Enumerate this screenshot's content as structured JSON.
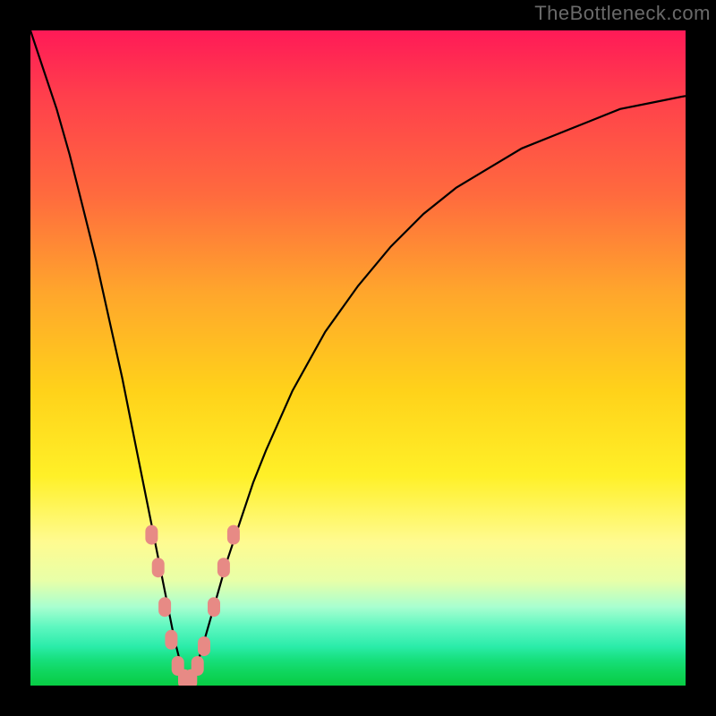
{
  "watermark": "TheBottleneck.com",
  "colors": {
    "bg_black": "#000000",
    "gradient_top": "#ff1a57",
    "gradient_bottom": "#08cc44",
    "curve": "#000000",
    "marker": "#e78a85"
  },
  "chart_data": {
    "type": "line",
    "title": "",
    "xlabel": "",
    "ylabel": "",
    "xlim": [
      0,
      100
    ],
    "ylim": [
      0,
      100
    ],
    "x_opt": 24,
    "series": [
      {
        "name": "bottleneck-curve",
        "x": [
          0,
          2,
          4,
          6,
          8,
          10,
          12,
          14,
          16,
          18,
          20,
          22,
          23,
          24,
          25,
          26,
          28,
          30,
          32,
          34,
          36,
          40,
          45,
          50,
          55,
          60,
          65,
          70,
          75,
          80,
          85,
          90,
          95,
          100
        ],
        "y": [
          100,
          94,
          88,
          81,
          73,
          65,
          56,
          47,
          37,
          27,
          17,
          7,
          3,
          0,
          2,
          5,
          12,
          19,
          25,
          31,
          36,
          45,
          54,
          61,
          67,
          72,
          76,
          79,
          82,
          84,
          86,
          88,
          89,
          90
        ]
      }
    ],
    "markers": {
      "name": "highlight-points",
      "x": [
        18.5,
        19.5,
        20.5,
        21.5,
        22.5,
        23.5,
        24.5,
        25.5,
        26.5,
        28.0,
        29.5,
        31.0
      ],
      "y": [
        23,
        18,
        12,
        7,
        3,
        1,
        1,
        3,
        6,
        12,
        18,
        23
      ]
    }
  }
}
